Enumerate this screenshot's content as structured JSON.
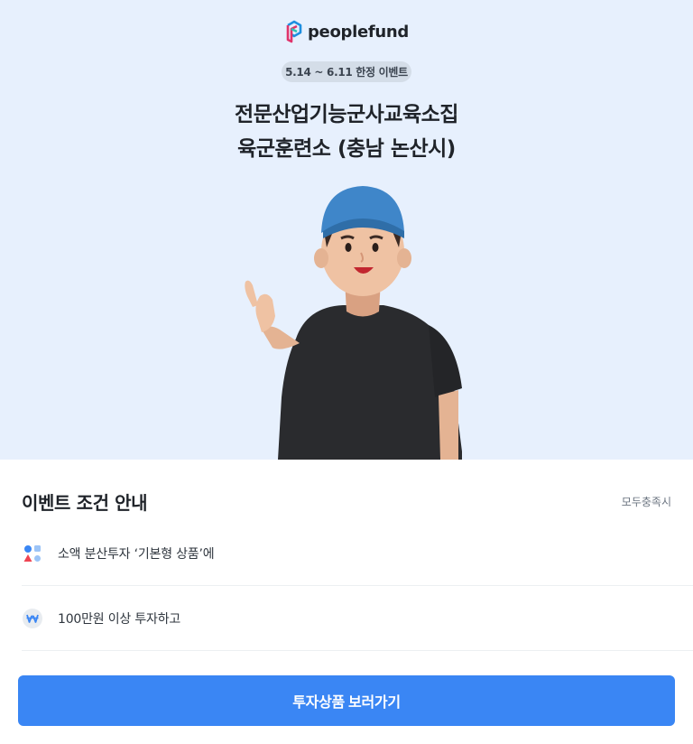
{
  "brand": {
    "name": "peoplefund"
  },
  "hero": {
    "badge": "5.14 ~ 6.11 한정 이벤트",
    "title_line1": "전문산업기능군사교육소집",
    "title_line2": "육군훈련소 (충남 논산시)"
  },
  "conditions": {
    "title": "이벤트 조건 안내",
    "note": "모두충족시",
    "items": [
      {
        "icon": "shapes-icon",
        "text": "소액 분산투자 ‘기본형 상품’에"
      },
      {
        "icon": "won-icon",
        "text": "100만원 이상 투자하고"
      }
    ]
  },
  "cta": {
    "label": "투자상품 보러가기"
  },
  "colors": {
    "hero_bg": "#e7f0fd",
    "primary": "#3a86f4",
    "badge_bg": "#d4dde8"
  }
}
